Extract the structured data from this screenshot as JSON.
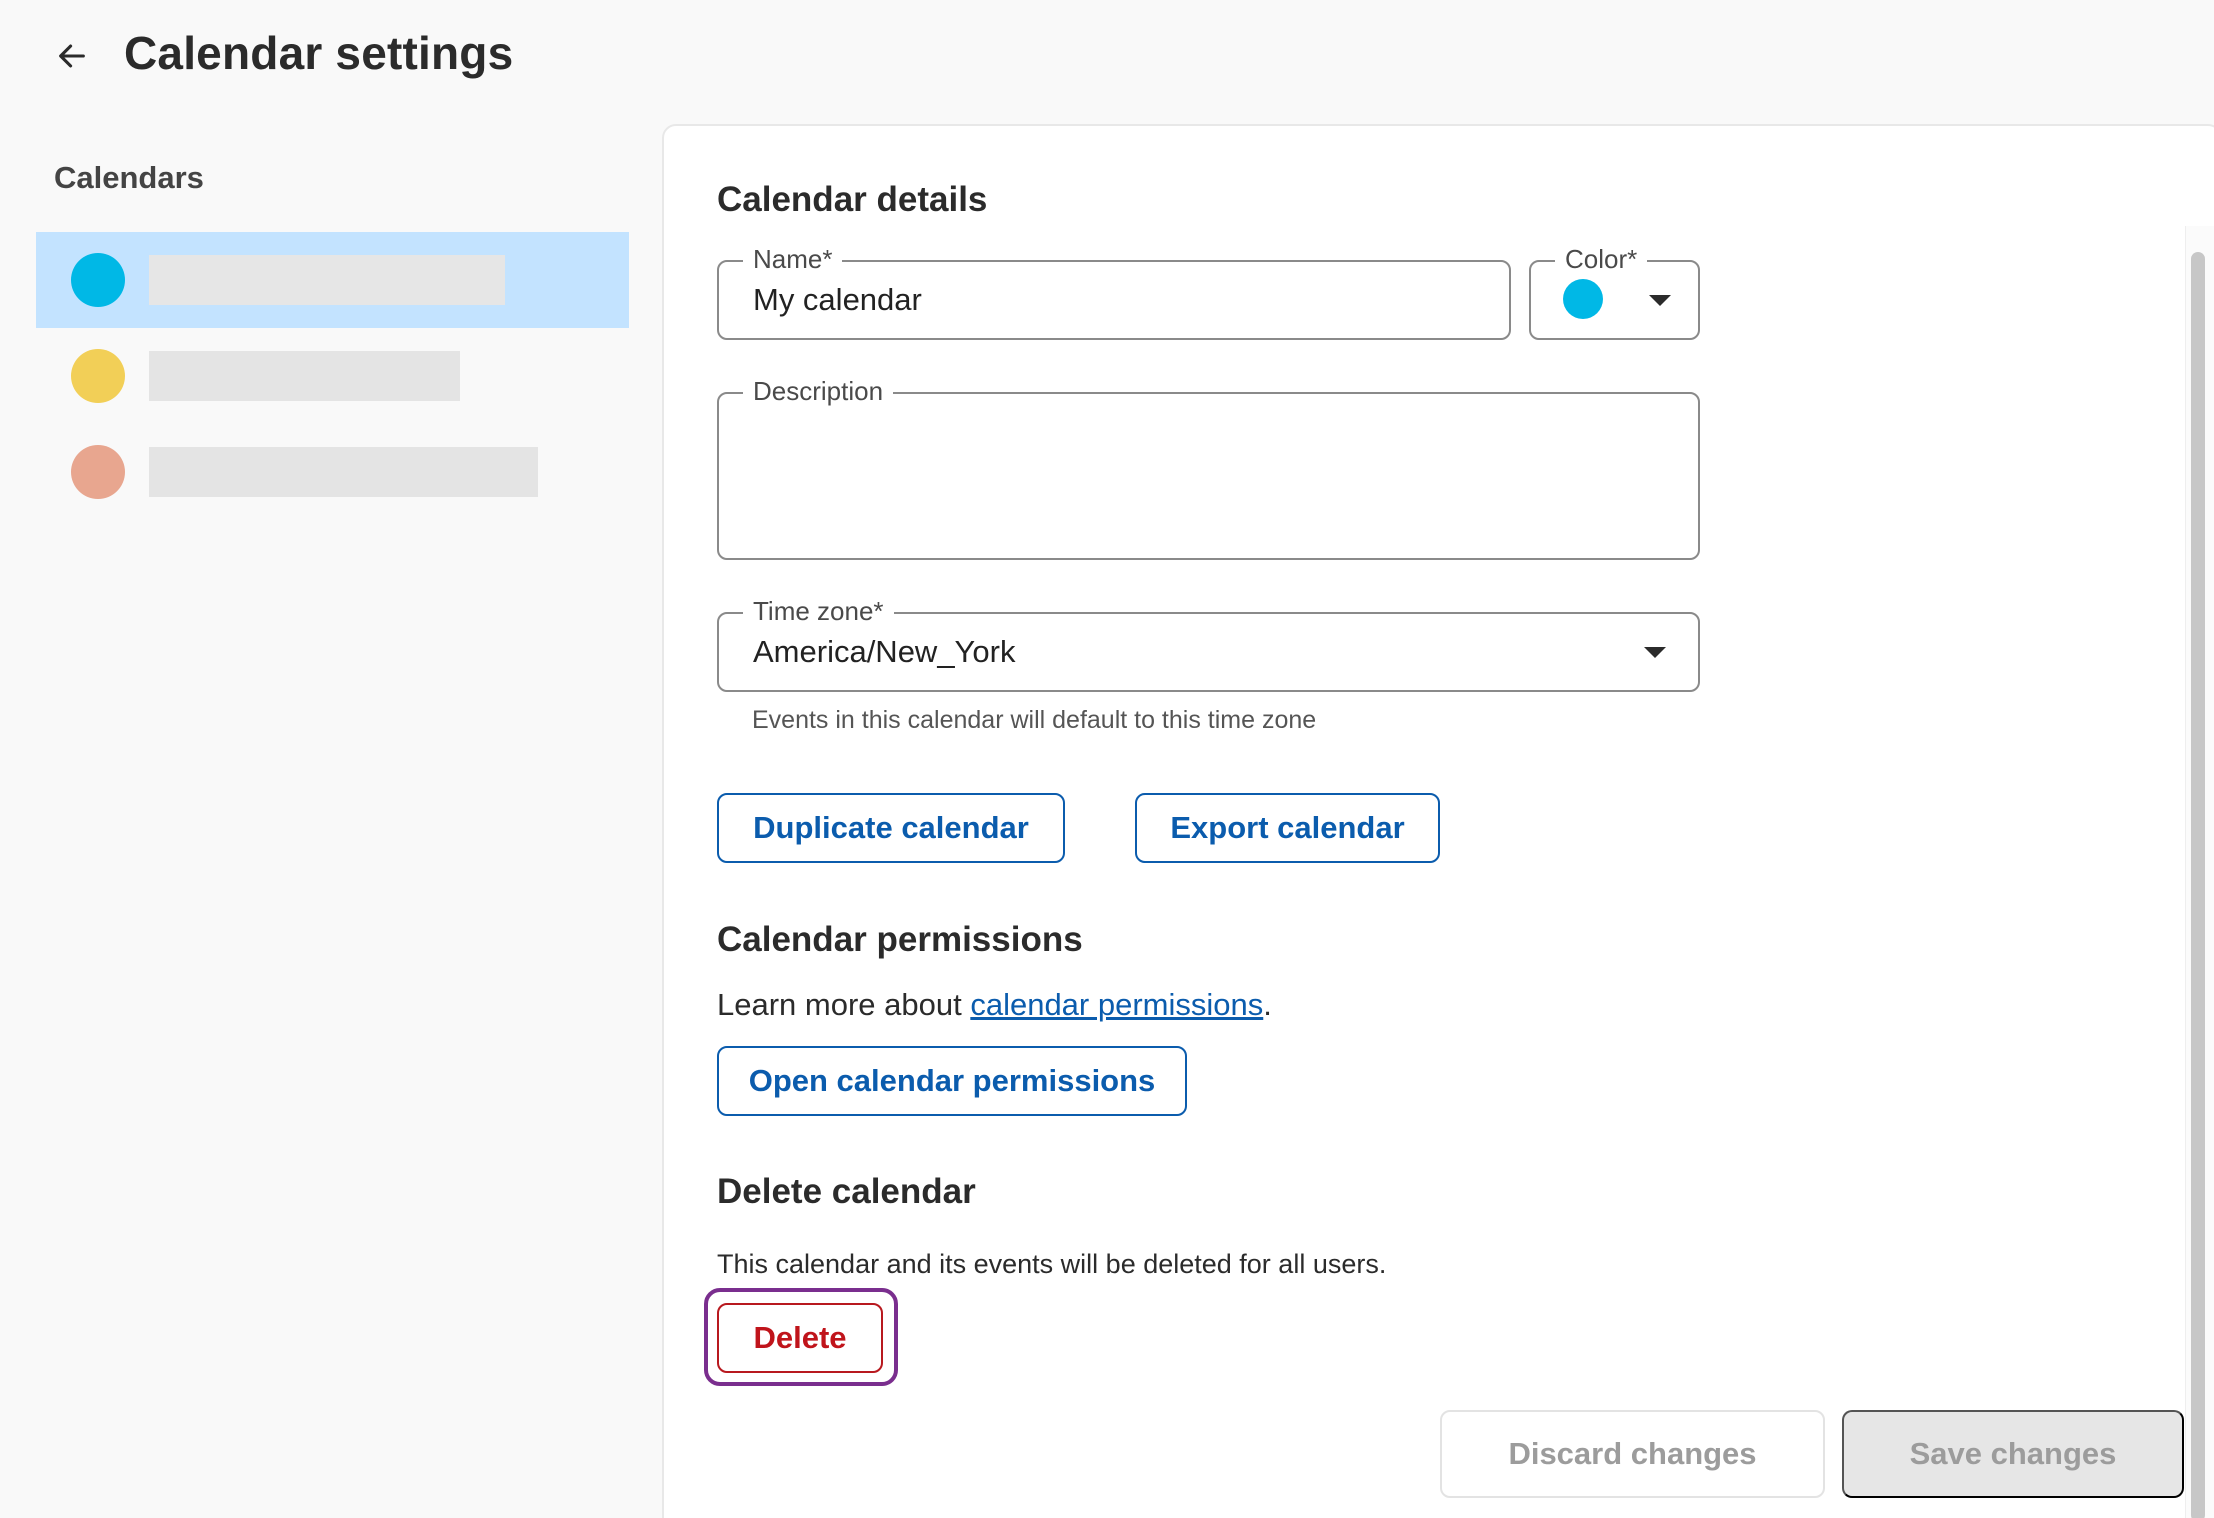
{
  "header": {
    "title": "Calendar settings",
    "back_icon": "arrow-left-icon"
  },
  "sidebar": {
    "heading": "Calendars",
    "calendars": [
      {
        "color": "#00b8e6",
        "selected": true
      },
      {
        "color": "#f2cf57",
        "selected": false
      },
      {
        "color": "#e8a68f",
        "selected": false
      }
    ]
  },
  "details": {
    "title": "Calendar details",
    "name_label": "Name",
    "name_value": "My calendar",
    "color_label": "Color",
    "color_value": "#00b8e6",
    "description_label": "Description",
    "description_value": "",
    "timezone_label": "Time zone",
    "timezone_value": "America/New_York",
    "timezone_helper": "Events in this calendar will default to this time zone",
    "required_mark": "*",
    "duplicate_label": "Duplicate calendar",
    "export_label": "Export calendar"
  },
  "permissions": {
    "title": "Calendar permissions",
    "text_prefix": "Learn more about ",
    "link_text": "calendar permissions",
    "text_suffix": ".",
    "open_label": "Open calendar permissions"
  },
  "delete": {
    "title": "Delete calendar",
    "description": "This calendar and its events will be deleted for all users.",
    "button_label": "Delete"
  },
  "footer": {
    "discard_label": "Discard changes",
    "save_label": "Save changes"
  },
  "colors": {
    "primary": "#0b5cad",
    "danger": "#c0141b",
    "focus": "#7a2e8e",
    "selected_bg": "#c3e3ff"
  }
}
